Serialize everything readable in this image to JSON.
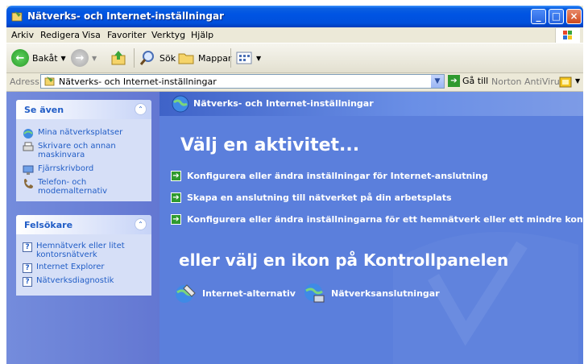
{
  "window": {
    "title": "Nätverks- och Internet-inställningar"
  },
  "menu": [
    "Arkiv",
    "Redigera",
    "Visa",
    "Favoriter",
    "Verktyg",
    "Hjälp"
  ],
  "toolbar": {
    "back": "Bakåt",
    "search": "Sök",
    "folders": "Mappar"
  },
  "address": {
    "label": "Adress",
    "value": "Nätverks- och Internet-inställningar",
    "go": "Gå till",
    "norton": "Norton AntiVirus"
  },
  "see_also": {
    "title": "Se även",
    "items": [
      "Mina nätverksplatser",
      "Skrivare och annan maskinvara",
      "Fjärrskrivbord",
      "Telefon- och modemalternativ"
    ]
  },
  "troubleshoot": {
    "title": "Felsökare",
    "items": [
      "Hemnätverk eller litet kontorsnätverk",
      "Internet Explorer",
      "Nätverksdiagnostik"
    ]
  },
  "main": {
    "header": "Nätverks- och Internet-inställningar",
    "pick_task": "Välj en aktivitet...",
    "tasks": [
      "Konfigurera eller ändra inställningar för Internet-anslutning",
      "Skapa en anslutning till nätverket på din arbetsplats",
      "Konfigurera eller ändra inställningarna för ett hemnätverk eller ett mindre kontorsnätverk"
    ],
    "or_pick_icon": "eller välj en ikon på Kontrollpanelen",
    "icons": [
      "Internet-alternativ",
      "Nätverksanslutningar"
    ]
  }
}
